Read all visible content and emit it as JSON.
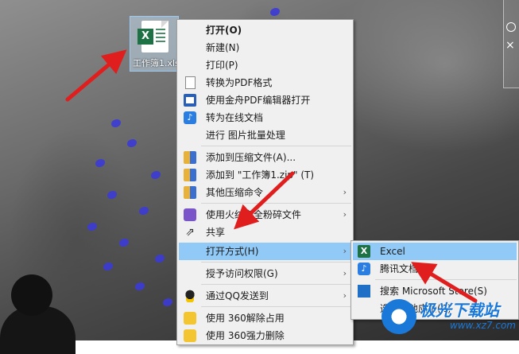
{
  "desktop": {
    "file_icon": {
      "badge": "X",
      "label": "工作簿1.xlsx"
    }
  },
  "context_menu": {
    "items": [
      {
        "label": "打开(O)",
        "icon": "",
        "bold": true
      },
      {
        "label": "新建(N)",
        "icon": ""
      },
      {
        "label": "打印(P)",
        "icon": ""
      },
      {
        "label": "转换为PDF格式",
        "icon": "pdf-doc-icon"
      },
      {
        "label": "使用金舟PDF编辑器打开",
        "icon": "jinzhou-pdf-icon"
      },
      {
        "label": "转为在线文档",
        "icon": "tencent-docs-icon"
      },
      {
        "label": "进行 图片批量处理",
        "icon": ""
      },
      {
        "label": "添加到压缩文件(A)...",
        "icon": "zip-icon"
      },
      {
        "label": "添加到 \"工作簿1.zip\" (T)",
        "icon": "zip-icon"
      },
      {
        "label": "其他压缩命令",
        "icon": "zip-icon",
        "submenu": true
      },
      {
        "label": "使用火绒安全粉碎文件",
        "icon": "huorong-icon",
        "submenu": true
      },
      {
        "label": "共享",
        "icon": "share-icon"
      },
      {
        "label": "打开方式(H)",
        "icon": "",
        "submenu": true,
        "highlighted": true
      },
      {
        "label": "授予访问权限(G)",
        "icon": "",
        "submenu": true
      },
      {
        "label": "通过QQ发送到",
        "icon": "qq-icon",
        "submenu": true
      },
      {
        "label": "使用 360解除占用",
        "icon": "360-icon"
      },
      {
        "label": "使用 360强力删除",
        "icon": "360-icon"
      }
    ]
  },
  "open_with_submenu": {
    "items": [
      {
        "label": "Excel",
        "icon": "excel-icon",
        "highlighted": true
      },
      {
        "label": "腾讯文档",
        "icon": "tencent-docs-icon"
      },
      {
        "label": "搜索 Microsoft Store(S)",
        "icon": "microsoft-store-icon"
      },
      {
        "label": "选择其他应用(C)",
        "icon": ""
      }
    ]
  },
  "watermark": {
    "title": "极光下载站",
    "url": "www.xz7.com"
  },
  "colors": {
    "menu_bg": "#f0f0f0",
    "highlight": "#91c9f7",
    "arrow_red": "#e01e1e",
    "excel_green": "#1e7145"
  }
}
